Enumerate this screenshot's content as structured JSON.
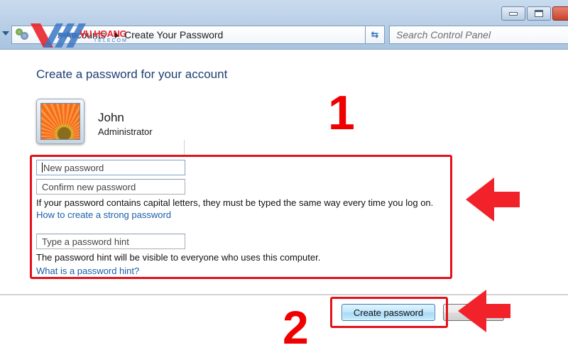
{
  "window": {
    "controls": {
      "minimize": "minimize",
      "maximize": "maximize",
      "close": "close"
    }
  },
  "addressbar": {
    "breadcrumb_prev": "s Accounts",
    "breadcrumb_current": "Create Your Password",
    "watermark": {
      "brand": "VU HOANG",
      "sub": "TELECOM"
    }
  },
  "search": {
    "placeholder": "Search Control Panel"
  },
  "page": {
    "title": "Create a password for your account",
    "user": {
      "name": "John",
      "role": "Administrator"
    },
    "form": {
      "new_password_placeholder": "New password",
      "confirm_password_placeholder": "Confirm new password",
      "capitals_note": "If your password contains capital letters, they must be typed the same way every time you log on.",
      "strong_password_link": "How to create a strong password",
      "hint_placeholder": "Type a password hint",
      "hint_note": "The password hint will be visible to everyone who uses this computer.",
      "hint_link": "What is a password hint?"
    },
    "buttons": {
      "create_password": "Create password",
      "cancel": ""
    }
  },
  "annotations": {
    "step1": "1",
    "step2": "2",
    "color": "#f00000"
  }
}
